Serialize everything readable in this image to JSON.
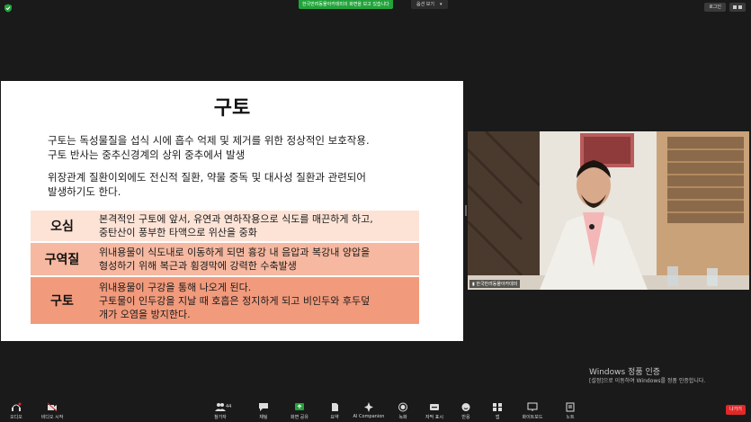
{
  "top_bar": {
    "share_banner": "한국반려동물아카데미의 화면을 보고 있습니다",
    "view_label": "옵션 보기",
    "login_label": "로그인"
  },
  "slide": {
    "title": "구토",
    "paragraph1_line1": "구토는 독성물질을 섭식 시에 흡수 억제 및 제거를 위한 정상적인 보호작용.",
    "paragraph1_line2": "구토 반사는 중추신경계의 상위 중추에서 발생",
    "paragraph2_line1": "위장관계 질환이외에도 전신적 질환, 약물 중독 및 대사성 질환과 관련되어",
    "paragraph2_line2": "발생하기도 한다.",
    "rows": [
      {
        "term": "오심",
        "lines": [
          "본격적인 구토에 앞서, 유연과 연하작용으로 식도를 매끈하게 하고,",
          "중탄산이 풍부한 타액으로 위산을 중화"
        ]
      },
      {
        "term": "구역질",
        "lines": [
          "위내용물이 식도내로 이동하게 되면 흉강 내 음압과 복강내 양압을",
          "형성하기 위해 복근과 횡경막에 강력한 수축발생"
        ]
      },
      {
        "term": "구토",
        "lines": [
          "위내용물이 구강을 통해 나오게 된다.",
          "구토물이 인두강을 지날 때 호흡은 정지하게 되고 비인두와 후두덮",
          "개가 오염을 방지한다."
        ]
      }
    ]
  },
  "video": {
    "participant_name": "한국반려동물아카데미"
  },
  "watermark": {
    "title": "Windows 정품 인증",
    "subtitle": "[설정]으로 이동하여 Windows를 정품 인증합니다."
  },
  "toolbar": {
    "audio": "오디오",
    "video": "비디오 시작",
    "participants": "참가자",
    "participants_count": "44",
    "chat": "채팅",
    "share": "화면 공유",
    "summary": "요약",
    "ai": "AI Companion",
    "record": "녹화",
    "captions": "자막 표시",
    "reactions": "반응",
    "apps": "앱",
    "whiteboard": "화이트보드",
    "notes": "노트",
    "leave": "나가기"
  },
  "colors": {
    "share_green": "#22a33b",
    "leave_red": "#e02828",
    "row1": "#fde3d6",
    "row2": "#f6b8a0",
    "row3": "#f19a7c"
  }
}
